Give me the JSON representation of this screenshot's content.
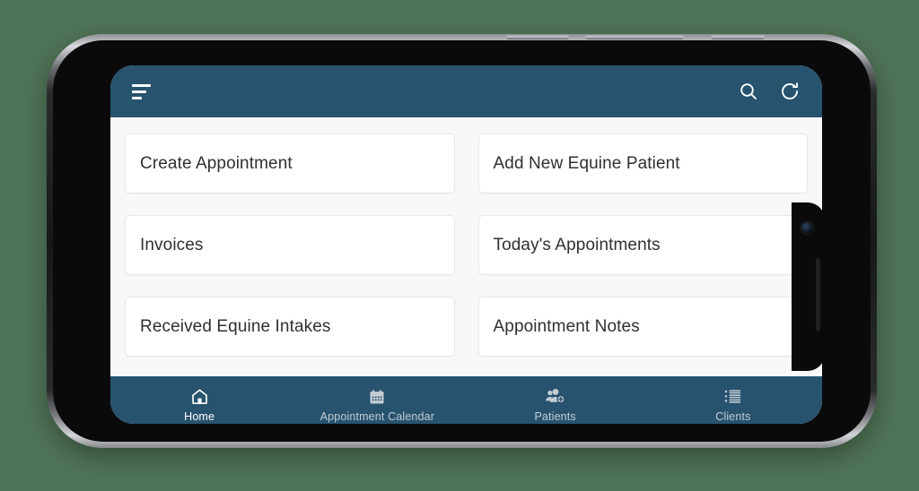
{
  "app": {
    "header": {
      "menu_icon": "hamburger-menu-icon",
      "search_icon": "search-icon",
      "refresh_icon": "refresh-icon",
      "background_color": "#27536f"
    },
    "screen_background": "#f7f8f8",
    "cards": [
      {
        "label": "Create Appointment"
      },
      {
        "label": "Add New Equine Patient"
      },
      {
        "label": "Invoices"
      },
      {
        "label": "Today's Appointments"
      },
      {
        "label": "Received Equine Intakes"
      },
      {
        "label": "Appointment Notes"
      }
    ],
    "bottom_nav": {
      "items": [
        {
          "label": "Home",
          "icon": "home-icon",
          "active": true
        },
        {
          "label": "Appointment Calendar",
          "icon": "calendar-icon",
          "active": false
        },
        {
          "label": "Patients",
          "icon": "person-add-icon",
          "active": false
        },
        {
          "label": "Clients",
          "icon": "list-icon",
          "active": false
        }
      ],
      "active_color": "#ffffff",
      "inactive_color": "#c3ccd3"
    }
  },
  "device": {
    "type": "smartphone-landscape",
    "notch_camera": "front-camera",
    "notch_speaker": "earpiece-speaker",
    "home_indicator": "home-indicator-bar",
    "side_buttons": [
      "volume-up-button",
      "volume-down-button",
      "power-button"
    ]
  }
}
